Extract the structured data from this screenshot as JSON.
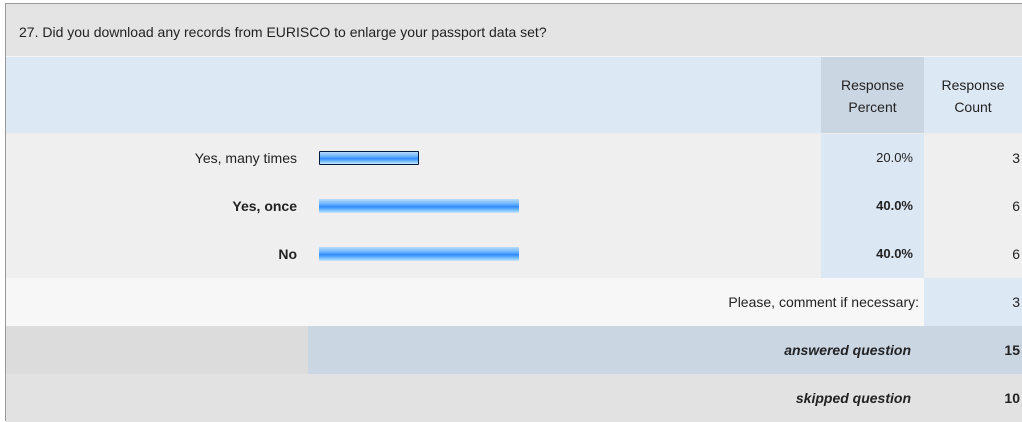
{
  "question": {
    "title": "27. Did you download any records from EURISCO to enlarge your passport data set?"
  },
  "header": {
    "response_percent": "Response\nPercent",
    "response_count": "Response\nCount"
  },
  "answers": [
    {
      "label": "Yes, many times",
      "percent": "20.0%",
      "count": "3",
      "bold": false,
      "fraction": 0.2
    },
    {
      "label": "Yes, once",
      "percent": "40.0%",
      "count": "6",
      "bold": true,
      "fraction": 0.4
    },
    {
      "label": "No",
      "percent": "40.0%",
      "count": "6",
      "bold": true,
      "fraction": 0.4
    }
  ],
  "comment": {
    "label": "Please, comment if necessary:",
    "count": "3"
  },
  "summary": {
    "answered_label": "answered question",
    "answered_count": "15",
    "skipped_label": "skipped question",
    "skipped_count": "10"
  }
}
